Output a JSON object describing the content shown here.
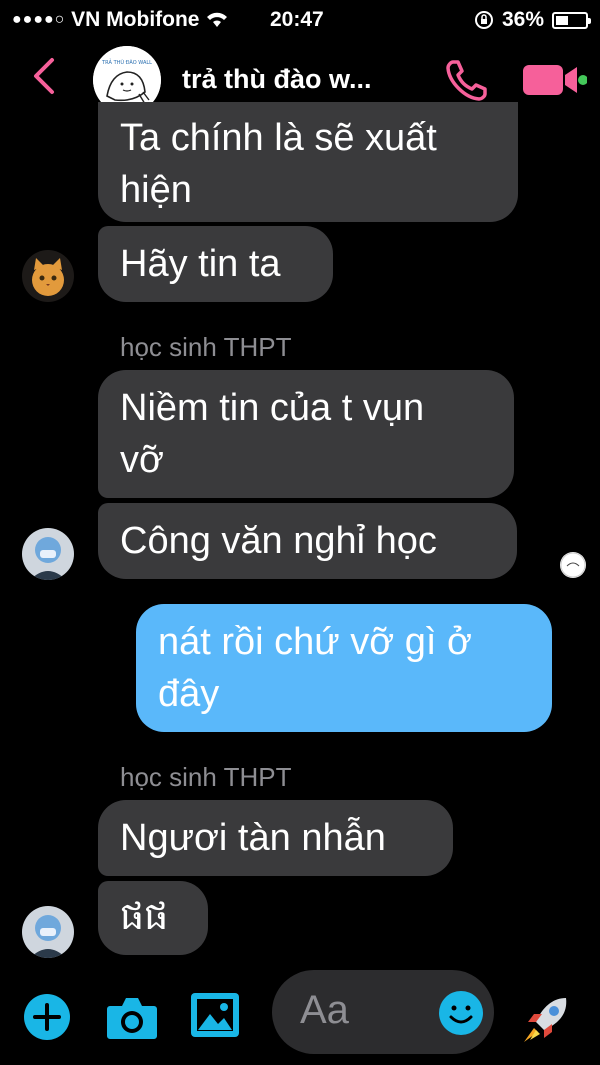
{
  "status_bar": {
    "signal": "●●●●○",
    "carrier": "VN Mobifone",
    "time": "20:47",
    "battery_percent": "36%",
    "battery_level": 0.36
  },
  "header": {
    "title": "trả thù đào w...",
    "avatar_text": "TRẢ THÙ ĐÀO WALL"
  },
  "messages": [
    {
      "id": "m1",
      "side": "left",
      "text_line1": "Ta chính là sẽ xuất",
      "text_line2": "hiện"
    },
    {
      "id": "m2",
      "side": "left",
      "text": "Hãy tin ta"
    },
    {
      "id": "m3",
      "sender": "học sinh THPT",
      "side": "left",
      "text_line1": "Niềm tin của t vụn",
      "text_line2": "vỡ"
    },
    {
      "id": "m4",
      "side": "left",
      "text": "Công văn nghỉ học"
    },
    {
      "id": "m5",
      "side": "right",
      "text_line1": "nát rồi chứ vỡ gì ở",
      "text_line2": "đây"
    },
    {
      "id": "m6",
      "sender": "học sinh THPT",
      "side": "left",
      "text": "Ngươi tàn nhẫn"
    },
    {
      "id": "m7",
      "side": "left",
      "text": "ផផ"
    }
  ],
  "composer": {
    "placeholder": "Aa"
  },
  "icons": [
    "back-chevron-icon",
    "phone-icon",
    "video-camera-icon",
    "plus-icon",
    "camera-icon",
    "photo-icon",
    "smiley-icon",
    "rocket-icon"
  ],
  "colors": {
    "accent_pink": "#f6609a",
    "bubble_gray": "#3a3a3c",
    "bubble_blue": "#5ab8fa",
    "composer_icon_cyan": "#19b6e6"
  }
}
